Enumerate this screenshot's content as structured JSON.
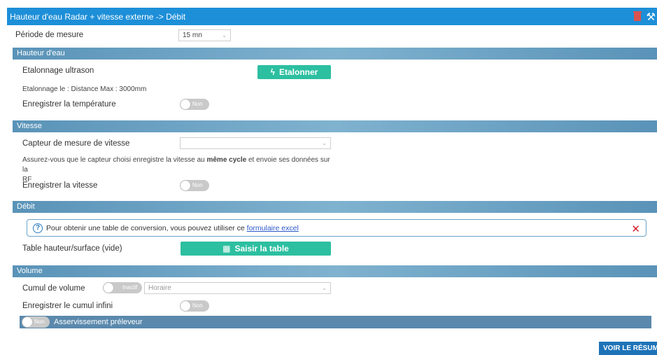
{
  "window": {
    "title": "Hauteur d'eau Radar + vitesse externe -> Débit"
  },
  "periode": {
    "label": "Période de mesure",
    "value": "15 mn"
  },
  "hauteur": {
    "section_title": "Hauteur d'eau",
    "etalonnage_label": "Etalonnage ultrason",
    "etalonner_button": "Etalonner",
    "etalonnage_info": "Etalonnage le : Distance Max : 3000mm",
    "temperature_label": "Enregistrer la température",
    "temperature_toggle": "Non"
  },
  "vitesse": {
    "section_title": "Vitesse",
    "capteur_label": "Capteur de mesure de vitesse",
    "capteur_value": "",
    "note_before": "Assurez-vous que le capteur choisi enregistre la vitesse au ",
    "note_bold": "même cycle",
    "note_after": " et envoie ses données sur la",
    "note_line2": "RF",
    "enregistrer_label": "Enregistrer la vitesse",
    "enregistrer_toggle": "Non"
  },
  "debit": {
    "section_title": "Débit",
    "info_text": "Pour obtenir une table de conversion, vous pouvez utiliser ce",
    "info_link": "formulaire excel",
    "table_label": "Table hauteur/surface (vide)",
    "saisir_button": "Saisir la table"
  },
  "volume": {
    "section_title": "Volume",
    "cumul_label": "Cumul de volume",
    "cumul_toggle": "Inactif",
    "cumul_select": "Horaire",
    "infini_label": "Enregistrer le cumul infini",
    "infini_toggle": "Non",
    "asservissement_toggle": "Non",
    "asservissement_label": "Asservissement préleveur"
  },
  "footer": {
    "resume_button": "VOIR LE RÉSUMÉ"
  },
  "colors": {
    "header": "#1d8fd8",
    "section": "#6ea3c4",
    "green": "#2cbfa0",
    "blue_button": "#1e73b8",
    "close": "#d0232a"
  },
  "icons": {
    "delete": "trash-icon",
    "settings": "wrench-icon",
    "calibrate": "bolt-icon",
    "table": "grid-icon",
    "help": "question-circle-icon",
    "close": "close-icon"
  }
}
